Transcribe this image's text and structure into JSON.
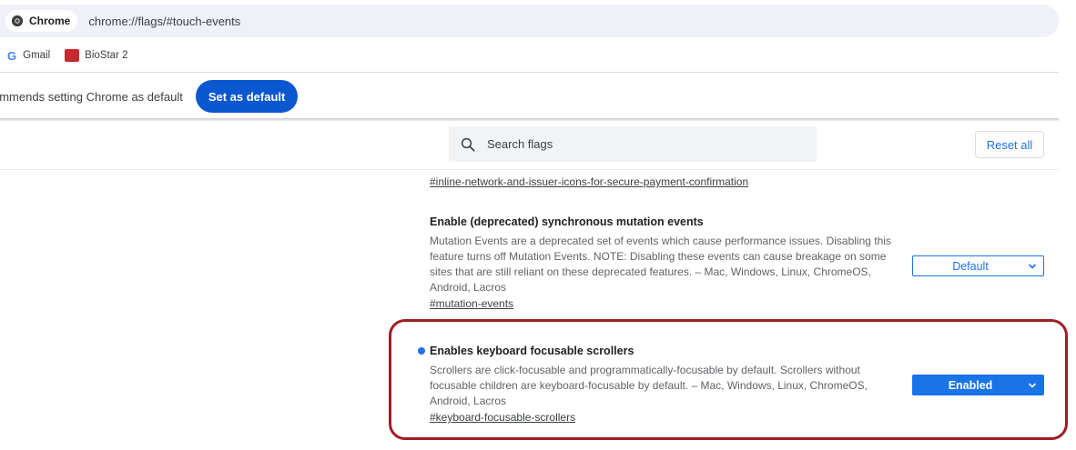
{
  "omnibox": {
    "chip_label": "Chrome",
    "url": "chrome://flags/#touch-events"
  },
  "bookmarks": [
    {
      "label": "Gmail",
      "icon": "google-icon"
    },
    {
      "label": "BioStar 2",
      "icon": "biostar-icon"
    }
  ],
  "infobar": {
    "message": "ommends setting Chrome as default",
    "button_label": "Set as default"
  },
  "flags_header": {
    "search_placeholder": "Search flags",
    "reset_label": "Reset all"
  },
  "previous_flag_link": "#inline-network-and-issuer-icons-for-secure-payment-confirmation",
  "experiments": [
    {
      "title": "Enable (deprecated) synchronous mutation events",
      "description": "Mutation Events are a deprecated set of events which cause performance issues. Disabling this feature turns off Mutation Events. NOTE: Disabling these events can cause breakage on some sites that are still reliant on these deprecated features. – Mac, Windows, Linux, ChromeOS, Android, Lacros",
      "link": "#mutation-events",
      "state": "Default"
    },
    {
      "title": "Enables keyboard focusable scrollers",
      "description": "Scrollers are click-focusable and programmatically-focusable by default. Scrollers without focusable children are keyboard-focusable by default. – Mac, Windows, Linux, ChromeOS, Android, Lacros",
      "link": "#keyboard-focusable-scrollers",
      "state": "Enabled"
    }
  ],
  "colors": {
    "accent": "#1a73e8",
    "primary_button": "#0b57d0",
    "highlight_border": "#a01d24"
  }
}
